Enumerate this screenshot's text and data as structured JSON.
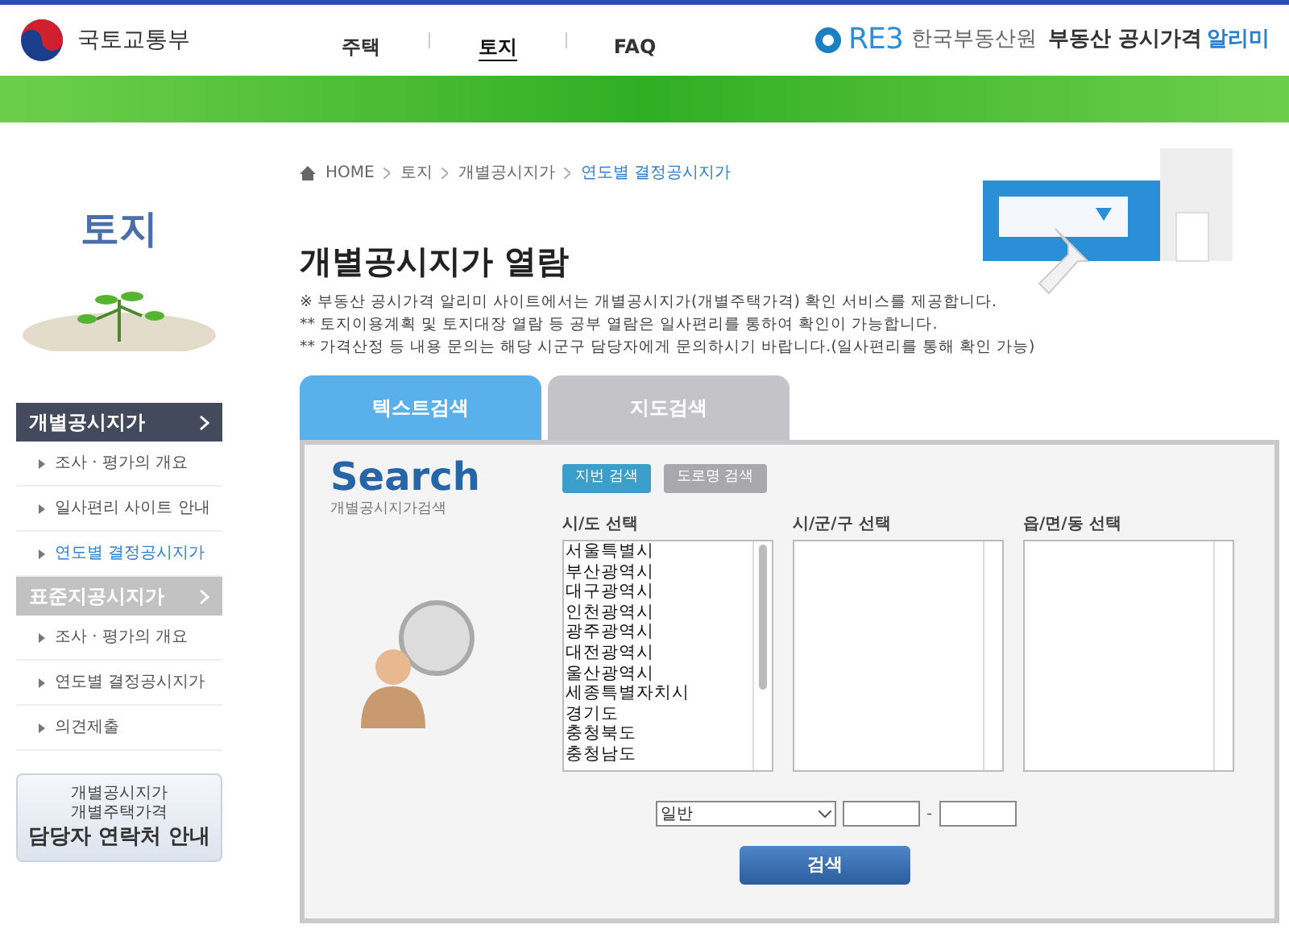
{
  "header": {
    "ministry": "국토교통부",
    "nav": [
      {
        "label": "주택",
        "selected": false
      },
      {
        "label": "토지",
        "selected": true
      },
      {
        "label": "FAQ",
        "selected": false
      }
    ],
    "agency_logo": "RE3",
    "agency": "한국부동산원",
    "service": "부동산 공시가격",
    "service_accent": "알리미"
  },
  "sidebar": {
    "title": "토지",
    "sections": [
      {
        "label": "개별공시지가",
        "selected": true,
        "items": [
          {
            "label": "조사 · 평가의 개요",
            "selected": false
          },
          {
            "label": "일사편리 사이트 안내",
            "selected": false
          },
          {
            "label": "연도별 결정공시지가",
            "selected": true
          }
        ]
      },
      {
        "label": "표준지공시지가",
        "selected": false,
        "items": [
          {
            "label": "조사 · 평가의 개요",
            "selected": false
          },
          {
            "label": "연도별 결정공시지가",
            "selected": false
          },
          {
            "label": "의견제출",
            "selected": false
          }
        ]
      }
    ],
    "contact": {
      "line1": "개별공시지가",
      "line2": "개별주택가격",
      "line3": "담당자 연락처 안내"
    }
  },
  "breadcrumb": [
    "HOME",
    "토지",
    "개별공시지가",
    "연도별 결정공시지가"
  ],
  "title": "개별공시지가 열람",
  "notes": [
    "※ 부동산 공시가격 알리미 사이트에서는 개별공시지가(개별주택가격) 확인 서비스를 제공합니다.",
    "** 토지이용계획 및 토지대장 열람 등 공부 열람은 일사편리를 통하여 확인이 가능합니다.",
    "** 가격산정 등 내용 문의는 해당 시군구 담당자에게 문의하시기 바랍니다.(일사편리를 통해 확인 가능)"
  ],
  "tabs": [
    {
      "label": "텍스트검색",
      "selected": true
    },
    {
      "label": "지도검색",
      "selected": false
    }
  ],
  "search_panel": {
    "logo": "Search",
    "subtitle": "개별공시지가검색",
    "modes": [
      {
        "label": "지번 검색",
        "selected": true
      },
      {
        "label": "도로명 검색",
        "selected": false
      }
    ],
    "lists": [
      {
        "label": "시/도 선택",
        "options": [
          "서울특별시",
          "부산광역시",
          "대구광역시",
          "인천광역시",
          "광주광역시",
          "대전광역시",
          "울산광역시",
          "세종특별자치시",
          "경기도",
          "충청북도",
          "충청남도"
        ]
      },
      {
        "label": "시/군/구 선택"
      },
      {
        "label": "읍/면/동 선택"
      }
    ],
    "lot_type": "일반",
    "separator": "-",
    "submit": "검색"
  }
}
